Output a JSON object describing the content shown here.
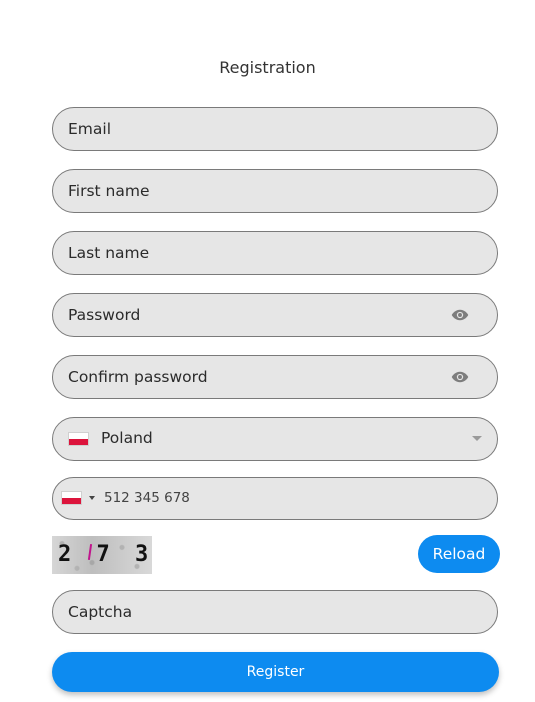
{
  "form": {
    "title": "Registration",
    "email_placeholder": "Email",
    "first_name_placeholder": "First name",
    "last_name_placeholder": "Last name",
    "password_placeholder": "Password",
    "confirm_password_placeholder": "Confirm password",
    "country": {
      "selected": "Poland",
      "flag_icon": "poland-flag-icon"
    },
    "phone": {
      "flag_icon": "poland-flag-icon",
      "value": "512 345 678"
    },
    "captcha": {
      "image_text": "2 7 3",
      "reload_label": "Reload",
      "placeholder": "Captcha"
    },
    "register_label": "Register"
  },
  "colors": {
    "accent": "#0d8bf0",
    "field_bg": "#e6e6e6",
    "field_border": "#7a7a7a"
  }
}
